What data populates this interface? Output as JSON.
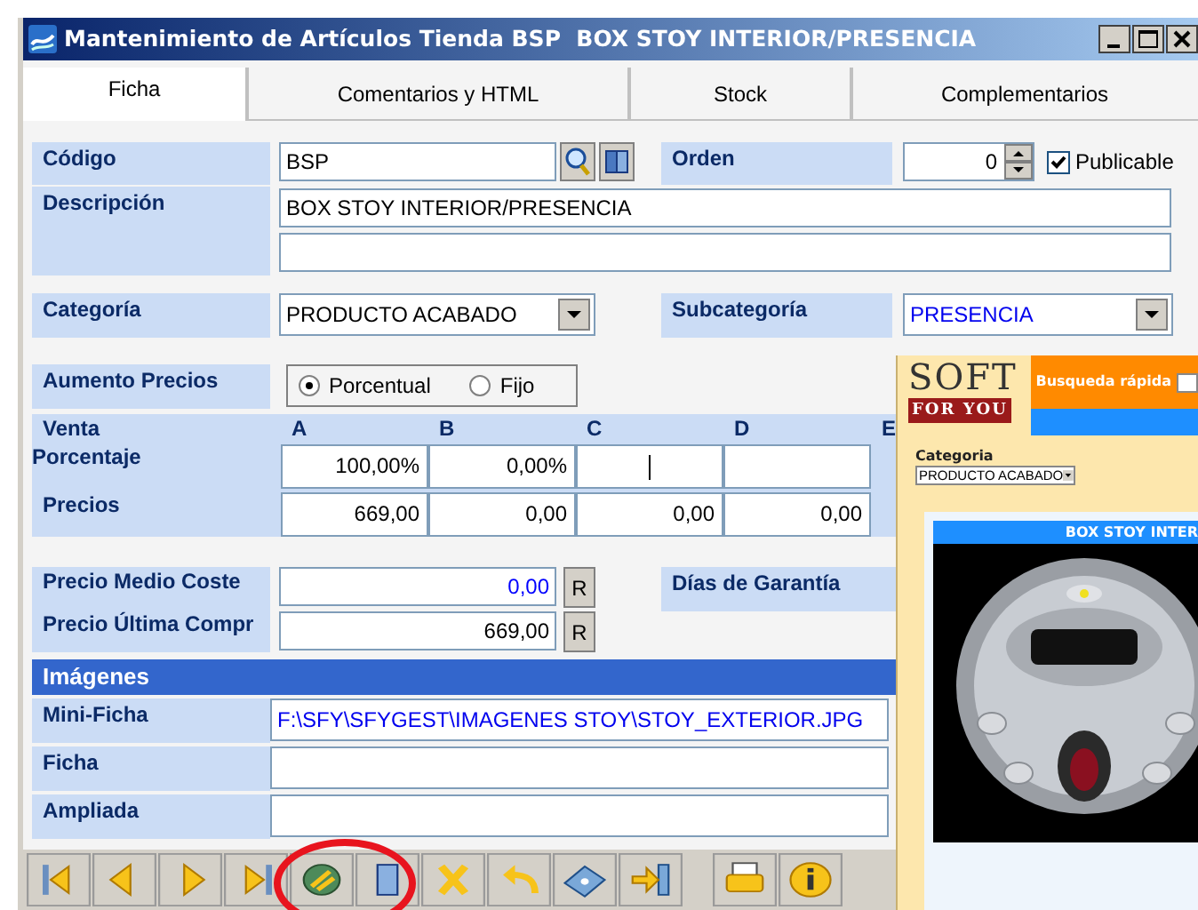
{
  "window": {
    "title": "Mantenimiento de Artículos Tienda BSP  BOX STOY INTERIOR/PRESENCIA"
  },
  "tabs": [
    {
      "label": "Ficha",
      "selected": true
    },
    {
      "label": "Comentarios y HTML",
      "selected": false
    },
    {
      "label": "Stock",
      "selected": false
    },
    {
      "label": "Complementarios",
      "selected": false
    }
  ],
  "codigo": {
    "label": "Código",
    "value": "BSP"
  },
  "orden": {
    "label": "Orden",
    "value": "0"
  },
  "publicable": {
    "label": "Publicable",
    "checked": true
  },
  "descripcion": {
    "label": "Descripción",
    "value": "BOX STOY INTERIOR/PRESENCIA"
  },
  "categoria": {
    "label": "Categoría",
    "value": "PRODUCTO ACABADO"
  },
  "subcategoria": {
    "label": "Subcategoría",
    "value": "PRESENCIA"
  },
  "aumento_precios": {
    "label": "Aumento Precios",
    "options": [
      {
        "label": "Porcentual",
        "selected": true
      },
      {
        "label": "Fijo",
        "selected": false
      }
    ]
  },
  "price_table": {
    "header_label": "Venta",
    "columns": [
      "A",
      "B",
      "C",
      "D",
      "E"
    ],
    "rows": [
      {
        "label": "Porcentaje",
        "cells": [
          {
            "value": "100,00%"
          },
          {
            "value": "0,00%"
          },
          {
            "focused": true
          },
          {}
        ]
      },
      {
        "label": "Precios",
        "cells": [
          {
            "value": "669,00"
          },
          {
            "value": "0,00"
          },
          {
            "value": "0,00"
          },
          {
            "value": "0,00"
          }
        ]
      }
    ]
  },
  "costs": [
    {
      "label": "Precio Medio Coste",
      "value": "0,00",
      "color": "#0000ff",
      "button": "R"
    },
    {
      "label": "Precio Última Compr",
      "value": "669,00",
      "color": "#000000",
      "button": "R"
    }
  ],
  "dias_garantia": {
    "label": "Días de Garantía"
  },
  "imagenes": {
    "title": "Imágenes",
    "rows": [
      {
        "label": "Mini-Ficha",
        "value": "F:\\SFY\\SFYGEST\\IMAGENES STOY\\STOY_EXTERIOR.JPG"
      },
      {
        "label": "Ficha"
      },
      {
        "label": "Ampliada"
      }
    ]
  },
  "web_preview": {
    "logo_top": "SOFT",
    "logo_bottom": "FOR YOU",
    "search_label": "Busqueda rápida",
    "category_label": "Categoria",
    "category_value": "PRODUCTO ACABADO",
    "product_title": "BOX STOY INTER"
  }
}
